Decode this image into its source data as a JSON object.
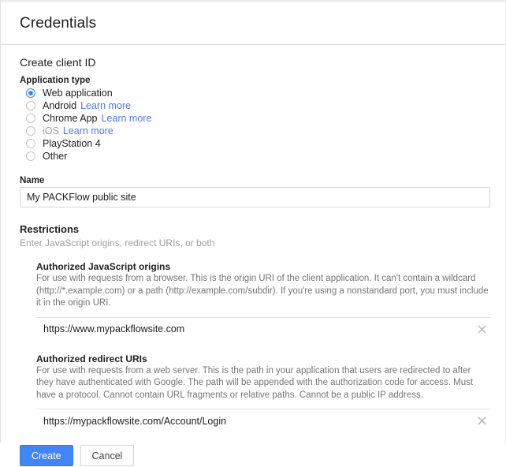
{
  "header": {
    "title": "Credentials"
  },
  "form": {
    "section_title": "Create client ID",
    "application_type": {
      "label": "Application type",
      "options": [
        {
          "label": "Web application",
          "selected": true,
          "learn_more": "",
          "muted": false
        },
        {
          "label": "Android",
          "selected": false,
          "learn_more": "Learn more",
          "muted": false
        },
        {
          "label": "Chrome App",
          "selected": false,
          "learn_more": "Learn more",
          "muted": false
        },
        {
          "label": "iOS",
          "selected": false,
          "learn_more": "Learn more",
          "muted": true
        },
        {
          "label": "PlayStation 4",
          "selected": false,
          "learn_more": "",
          "muted": false
        },
        {
          "label": "Other",
          "selected": false,
          "learn_more": "",
          "muted": false
        }
      ]
    },
    "name": {
      "label": "Name",
      "value": "My PACKFlow public site",
      "placeholder": ""
    },
    "restrictions": {
      "title": "Restrictions",
      "subtitle": "Enter JavaScript origins, redirect URIs, or both",
      "groups": [
        {
          "title": "Authorized JavaScript origins",
          "description": "For use with requests from a browser. This is the origin URI of the client application. It can't contain a wildcard (http://*.example.com) or a path (http://example.com/subdir). If you're using a nonstandard port, you must include it in the origin URI.",
          "value": "https://www.mypackflowsite.com",
          "placeholder": "",
          "remove_icon": "close-icon"
        },
        {
          "title": "Authorized redirect URIs",
          "description": "For use with requests from a web server. This is the path in your application that users are redirected to after they have authenticated with Google. The path will be appended with the authorization code for access. Must have a protocol. Cannot contain URL fragments or relative paths. Cannot be a public IP address.",
          "value": "https://mypackflowsite.com/Account/Login",
          "placeholder": "",
          "remove_icon": "close-icon"
        }
      ]
    },
    "actions": {
      "create_label": "Create",
      "cancel_label": "Cancel"
    }
  },
  "colors": {
    "accent": "#4285f4",
    "link": "#4e7ae6",
    "muted_text": "#9aa0a6",
    "description_text": "#757575"
  }
}
